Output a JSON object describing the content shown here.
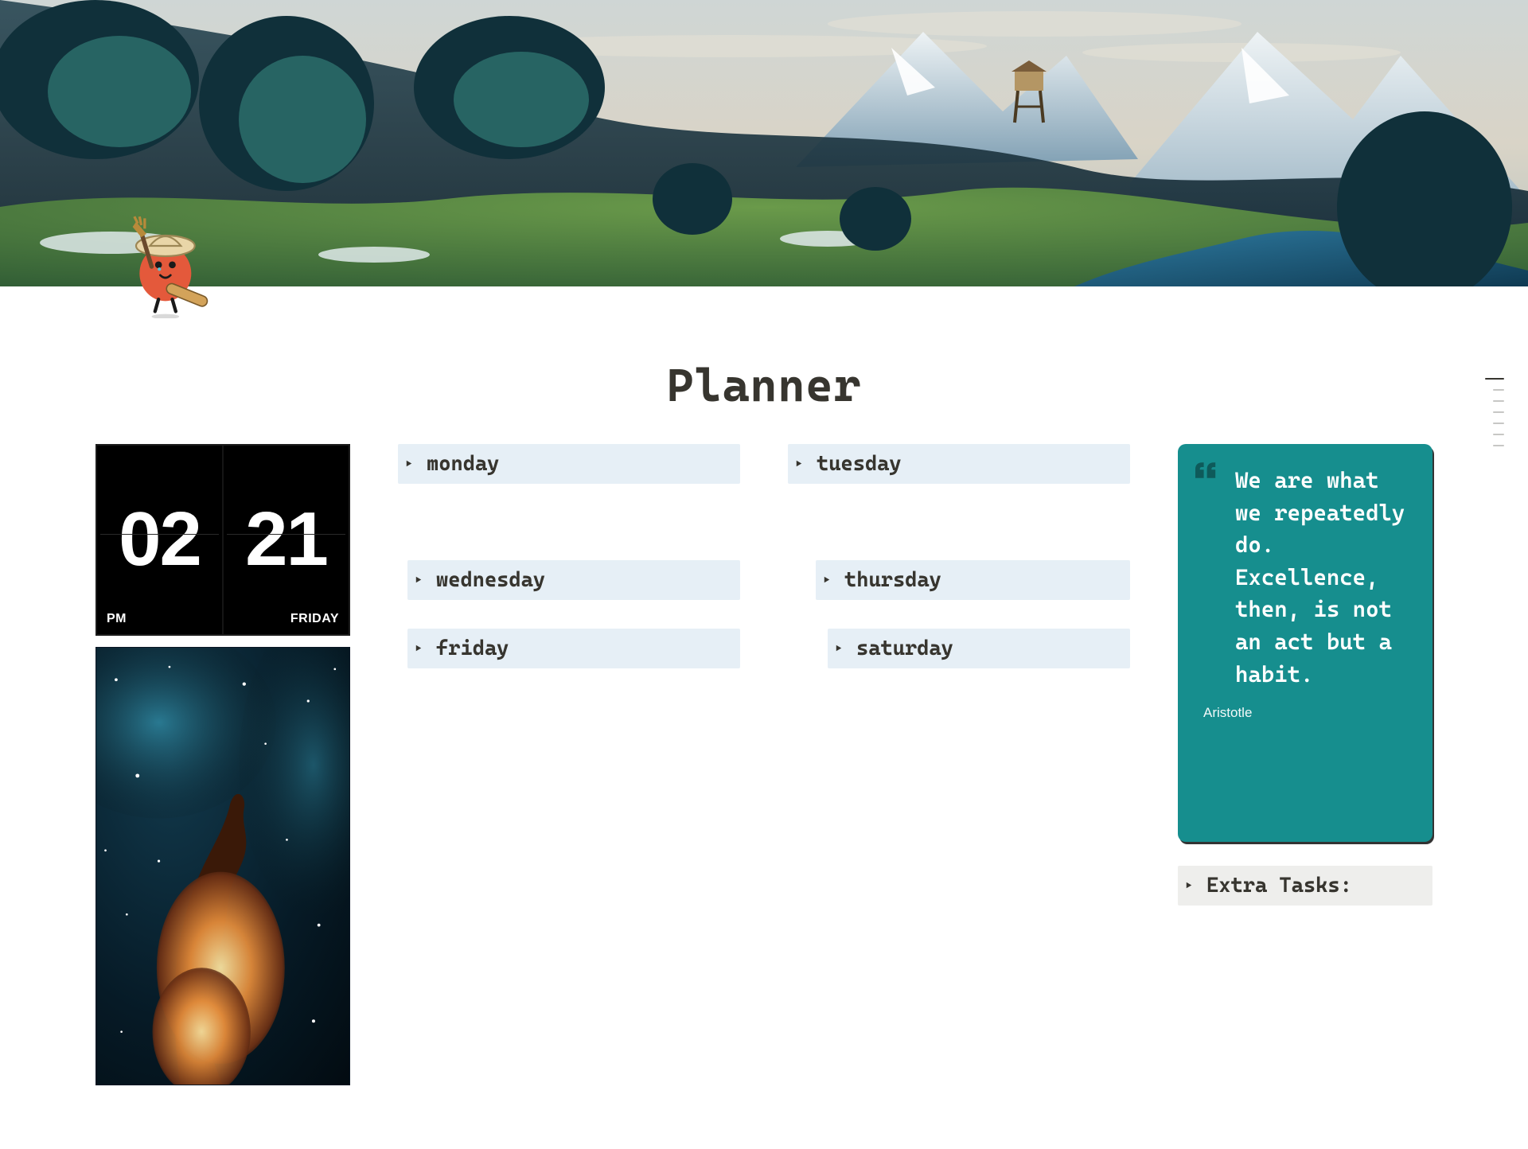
{
  "page_title": "Planner",
  "clock": {
    "hour": "02",
    "minute": "21",
    "meridiem": "PM",
    "day_of_week": "FRIDAY"
  },
  "days": {
    "monday": {
      "label": "monday"
    },
    "tuesday": {
      "label": "tuesday"
    },
    "wednesday": {
      "label": "wednesday"
    },
    "thursday": {
      "label": "thursday"
    },
    "friday": {
      "label": "friday"
    },
    "saturday": {
      "label": "saturday"
    }
  },
  "quote": {
    "text": "We are what we repeatedly do. Excellence, then, is not an act but a habit.",
    "author": "Aristotle"
  },
  "extra_tasks": {
    "label": "Extra Tasks:"
  },
  "colors": {
    "day_toggle_bg": "#e6eff6",
    "quote_bg": "#168e8e",
    "extra_bg": "#eeeeec"
  }
}
